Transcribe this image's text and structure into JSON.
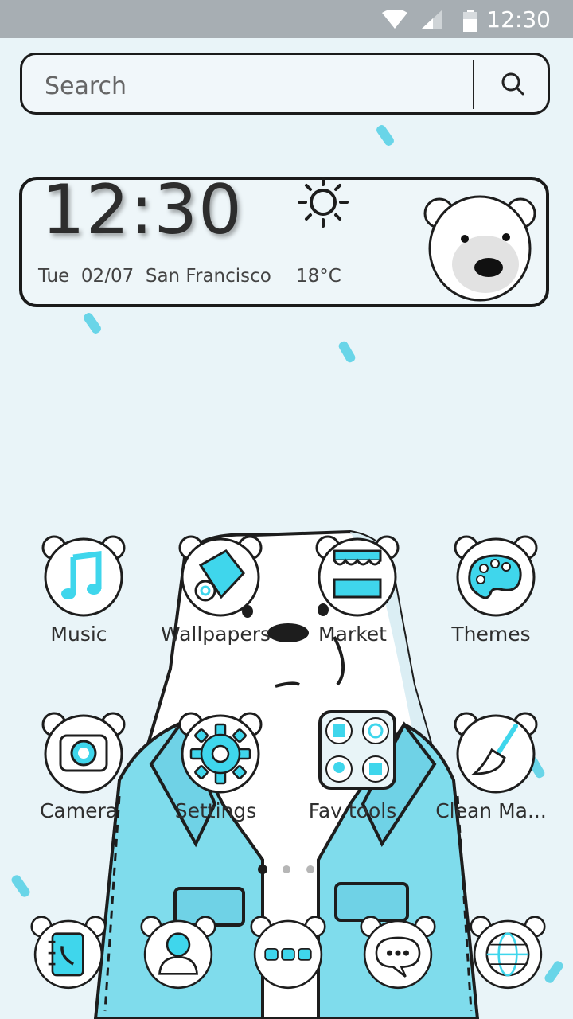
{
  "status_bar": {
    "time": "12:30"
  },
  "search": {
    "placeholder": "Search"
  },
  "widget": {
    "time": "12:30",
    "day": "Tue",
    "date": "02/07",
    "city": "San Francisco",
    "temperature": "18°C",
    "weather_icon": "sun-icon"
  },
  "apps_row1": [
    {
      "label": "Music",
      "icon": "music-note-icon"
    },
    {
      "label": "Wallpapers",
      "icon": "wallpaper-scroll-icon"
    },
    {
      "label": "Market",
      "icon": "market-store-icon"
    },
    {
      "label": "Themes",
      "icon": "palette-icon"
    }
  ],
  "apps_row2": [
    {
      "label": "Camera",
      "icon": "camera-icon"
    },
    {
      "label": "Settings",
      "icon": "gear-icon"
    },
    {
      "label": "Fav tools",
      "icon": "folder-icon"
    },
    {
      "label": "Clean Ma...",
      "icon": "broom-icon"
    }
  ],
  "page_indicator": {
    "pages": 3,
    "active": 1
  },
  "dock": [
    "contacts-icon",
    "person-icon",
    "app-drawer-icon",
    "messages-icon",
    "browser-globe-icon"
  ],
  "colors": {
    "accent": "#3fd6ec",
    "jacket": "#7fdcec",
    "background": "#e9f4f8"
  }
}
